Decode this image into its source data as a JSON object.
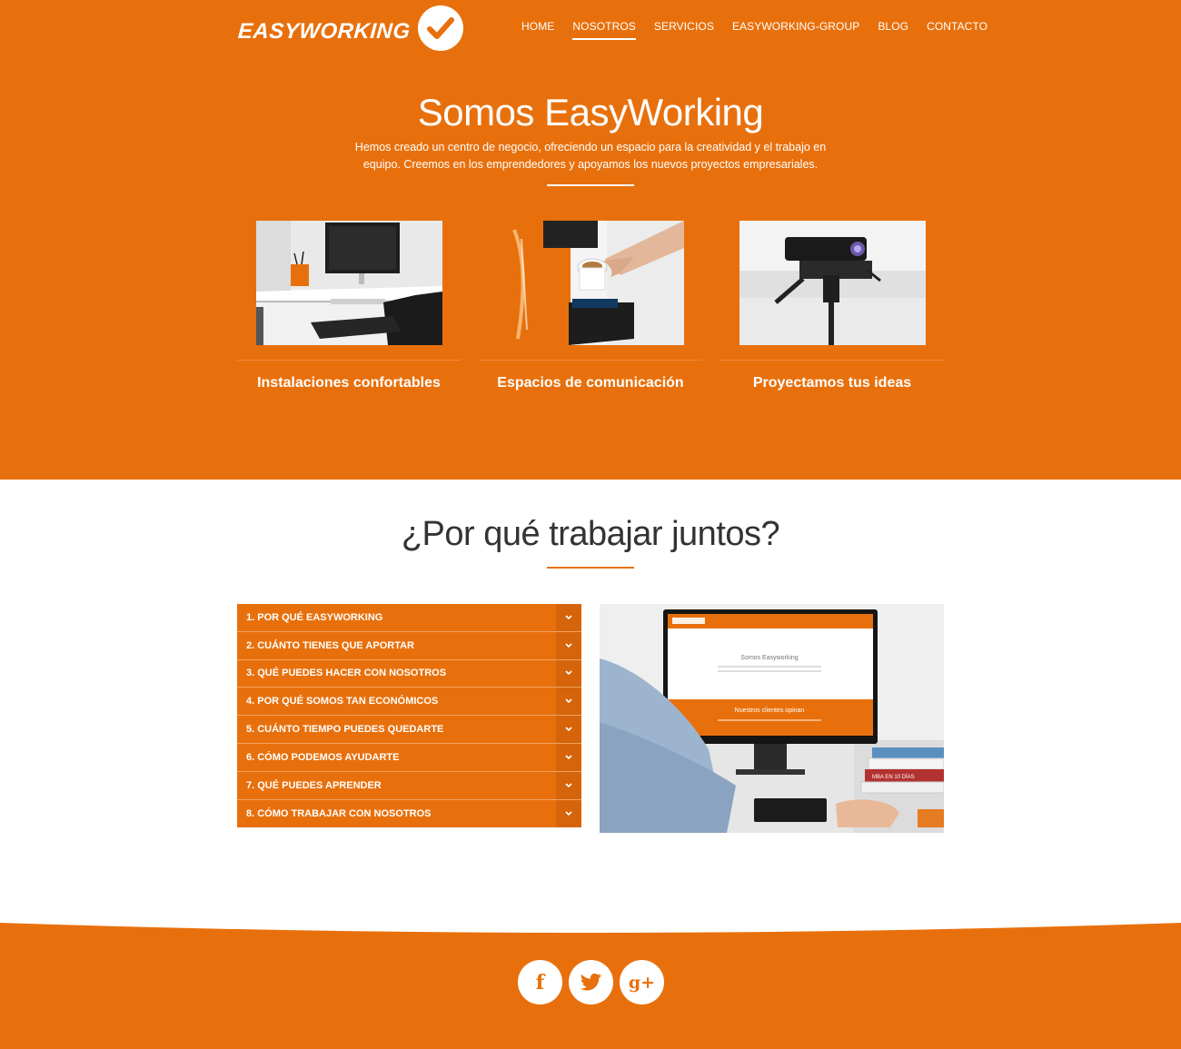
{
  "brand": {
    "logo_text": "EASYWORKING",
    "accent": "#e8700c",
    "accent_dark": "#d5640a"
  },
  "nav": {
    "items": [
      {
        "label": "HOME"
      },
      {
        "label": "NOSOTROS"
      },
      {
        "label": "SERVICIOS"
      },
      {
        "label": "EASYWORKING-GROUP"
      },
      {
        "label": "BLOG"
      },
      {
        "label": "CONTACTO"
      }
    ],
    "active": "NOSOTROS"
  },
  "hero": {
    "title": "Somos EasyWorking",
    "description": "Hemos creado un centro de negocio, ofreciendo un espacio para la creatividad y el trabajo en equipo. Creemos en los emprendedores y apoyamos los nuevos proyectos empresariales.",
    "features": [
      {
        "title": "Instalaciones confortables",
        "image": "office-desk-photo"
      },
      {
        "title": "Espacios de comunicación",
        "image": "coffee-machine-photo"
      },
      {
        "title": "Proyectamos tus ideas",
        "image": "projector-photo"
      }
    ]
  },
  "why": {
    "title": "¿Por qué trabajar juntos?",
    "accordion": [
      {
        "label": "1. POR QUÉ EASYWORKING"
      },
      {
        "label": "2. CUÁNTO TIENES QUE APORTAR"
      },
      {
        "label": "3. QUÉ PUEDES HACER CON NOSOTROS"
      },
      {
        "label": "4. POR QUÉ SOMOS TAN ECONÓMICOS"
      },
      {
        "label": "5. CUÁNTO TIEMPO PUEDES QUEDARTE"
      },
      {
        "label": "6. CÓMO PODEMOS AYUDARTE"
      },
      {
        "label": "7. QUÉ PUEDES APRENDER"
      },
      {
        "label": "8. CÓMO TRABAJAR CON NOSOTROS"
      }
    ],
    "photo": {
      "screen_title": "Somos Easyworking",
      "screen_banner": "Nuestros clientes opinan",
      "book_label": "MBA EN 10 DÍAS"
    }
  },
  "footer": {
    "social": [
      {
        "name": "facebook-icon",
        "glyph": "f"
      },
      {
        "name": "twitter-icon",
        "glyph": ""
      },
      {
        "name": "google-plus-icon",
        "glyph": "g+"
      }
    ]
  }
}
